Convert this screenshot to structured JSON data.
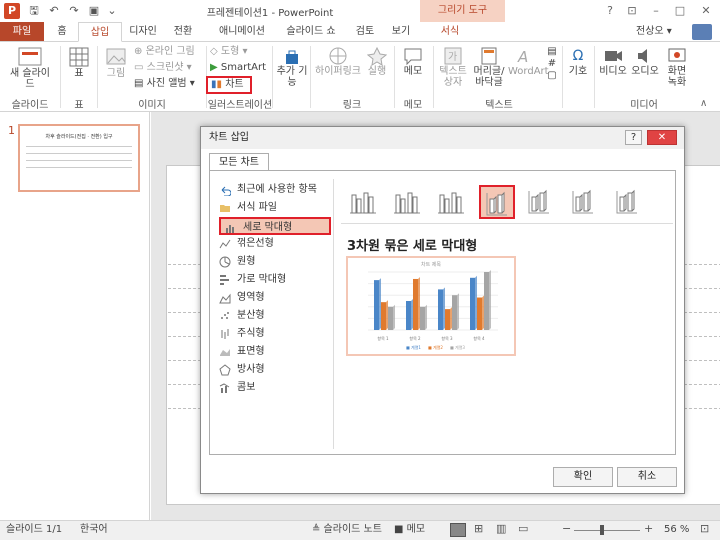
{
  "window": {
    "title": "프레젠테이션1 - PowerPoint",
    "context_header": "그리기 도구",
    "user": "전상오 ▾"
  },
  "tabs": {
    "file": "파일",
    "home": "홈",
    "insert": "삽입",
    "design": "디자인",
    "transitions": "전환",
    "animations": "애니메이션",
    "slideshow": "슬라이드 쇼",
    "review": "검토",
    "view": "보기",
    "format": "서식"
  },
  "ribbon": {
    "new_slide": "새 슬라이드",
    "table": "표",
    "picture": "그림",
    "online_picture": "온라인 그림",
    "screenshot": "스크린샷 ▾",
    "photo_album": "사진 앨범 ▾",
    "shapes": "도형 ▾",
    "smartart": "SmartArt",
    "chart": "차트",
    "addin": "추가 기능",
    "hyperlink": "하이퍼링크",
    "action": "실행",
    "comment": "메모",
    "textbox": "텍스트 상자",
    "header_footer": "머리글/ 바닥글",
    "wordart": "WordArt",
    "symbol": "기호",
    "video": "비디오",
    "audio": "오디오",
    "screen_rec": "화면 녹화",
    "groups": {
      "slides": "슬라이드",
      "tables": "표",
      "images": "이미지",
      "illustrations": "일러스트레이션",
      "links": "링크",
      "comments": "메모",
      "text": "텍스트",
      "media": "미디어"
    }
  },
  "slide_panel": {
    "number": "1",
    "thumb_title": "차후 슬라이드(전집 · 전환) 입구"
  },
  "dialog": {
    "title": "차트 삽입",
    "tab": "모든 차트",
    "categories": [
      {
        "label": "최근에 사용한 항목",
        "icon": "undo-icon"
      },
      {
        "label": "서식 파일",
        "icon": "folder-icon"
      },
      {
        "label": "세로 막대형",
        "icon": "column-chart-icon"
      },
      {
        "label": "꺾은선형",
        "icon": "line-chart-icon"
      },
      {
        "label": "원형",
        "icon": "pie-chart-icon"
      },
      {
        "label": "가로 막대형",
        "icon": "bar-chart-icon"
      },
      {
        "label": "영역형",
        "icon": "area-chart-icon"
      },
      {
        "label": "분산형",
        "icon": "scatter-chart-icon"
      },
      {
        "label": "주식형",
        "icon": "stock-chart-icon"
      },
      {
        "label": "표면형",
        "icon": "surface-chart-icon"
      },
      {
        "label": "방사형",
        "icon": "radar-chart-icon"
      },
      {
        "label": "콤보",
        "icon": "combo-chart-icon"
      }
    ],
    "selected_category_index": 2,
    "selected_gallery_index": 3,
    "chart_type_name": "3차원 묶은 세로 막대형",
    "ok": "확인",
    "cancel": "취소",
    "help": "?",
    "close": "✕"
  },
  "preview": {
    "title": "차트 제목",
    "categories": [
      "항목 1",
      "항목 2",
      "항목 3",
      "항목 4"
    ],
    "legend": [
      "■ 계열1",
      "■ 계열2",
      "■ 계열3"
    ],
    "series": [
      {
        "values": [
          4.3,
          2.5,
          3.5,
          4.5
        ],
        "color": "#4a86c8"
      },
      {
        "values": [
          2.4,
          4.4,
          1.8,
          2.8
        ],
        "color": "#e07a2e"
      },
      {
        "values": [
          2,
          2,
          3,
          5
        ],
        "color": "#a5a5a5"
      }
    ]
  },
  "status": {
    "slide": "슬라이드 1/1",
    "lang": "한국어",
    "notes": "≜ 슬라이드 노트",
    "comments": "■ 메모",
    "zoom": "56 %"
  }
}
